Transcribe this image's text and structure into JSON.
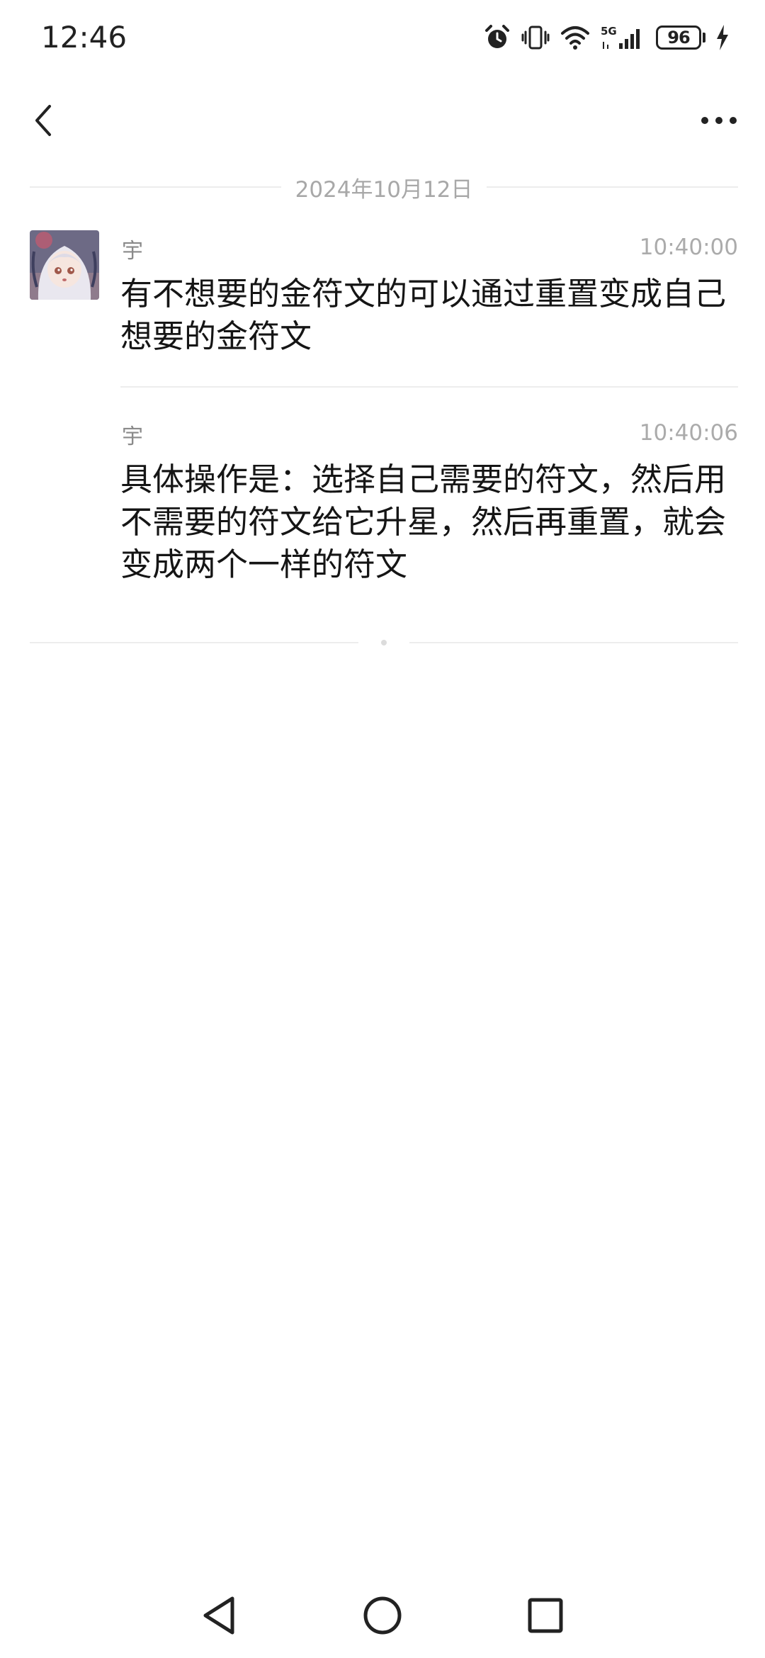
{
  "status_bar": {
    "time": "12:46",
    "network": "5G",
    "battery_level": "96",
    "icons": [
      "alarm-icon",
      "vibrate-icon",
      "wifi-icon",
      "signal-5g-icon",
      "battery-icon",
      "charging-icon"
    ]
  },
  "header": {
    "back_icon": "chevron-left-icon",
    "more_icon": "more-horizontal-icon"
  },
  "date_divider": "2024年10月12日",
  "messages": [
    {
      "sender": "宇",
      "time": "10:40:00",
      "text": "有不想要的金符文的可以通过重置变成自己想要的金符文"
    },
    {
      "sender": "宇",
      "time": "10:40:06",
      "text": "具体操作是：选择自己需要的符文，然后用不需要的符文给它升星，然后再重置，就会变成两个一样的符文"
    }
  ],
  "nav_bar": {
    "icons": [
      "nav-back-icon",
      "nav-home-icon",
      "nav-recents-icon"
    ]
  },
  "colors": {
    "background": "#ffffff",
    "text": "#151515",
    "meta_text": "#ababab",
    "divider": "#ececec"
  }
}
